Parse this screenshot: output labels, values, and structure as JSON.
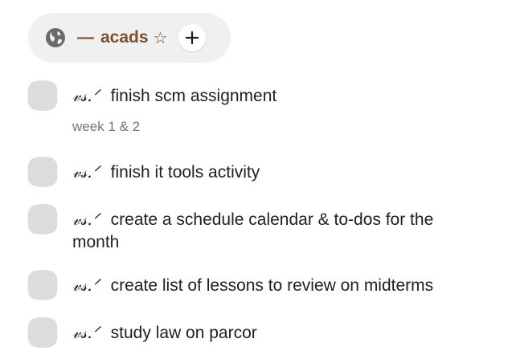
{
  "header": {
    "dash": "—",
    "title": "acads",
    "star": "☆",
    "add_label": "+"
  },
  "tasks": [
    {
      "prefix": "𝓋𝓈.ᐟ",
      "text": "finish scm assignment"
    },
    {
      "prefix": "𝓋𝓈.ᐟ",
      "text": "finish it tools activity"
    },
    {
      "prefix": "𝓋𝓈.ᐟ",
      "text": "create a schedule calendar & to-dos for the",
      "text_cont": "month"
    },
    {
      "prefix": "𝓋𝓈.ᐟ",
      "text": "create list of lessons to review on midterms"
    },
    {
      "prefix": "𝓋𝓈.ᐟ",
      "text": "study law on parcor"
    }
  ],
  "subtask_note": "week 1 & 2",
  "colors": {
    "accent": "#7a5230",
    "pill_bg": "#f0f0f0",
    "checkbox": "#dcdcdc",
    "muted_text": "#757575"
  }
}
